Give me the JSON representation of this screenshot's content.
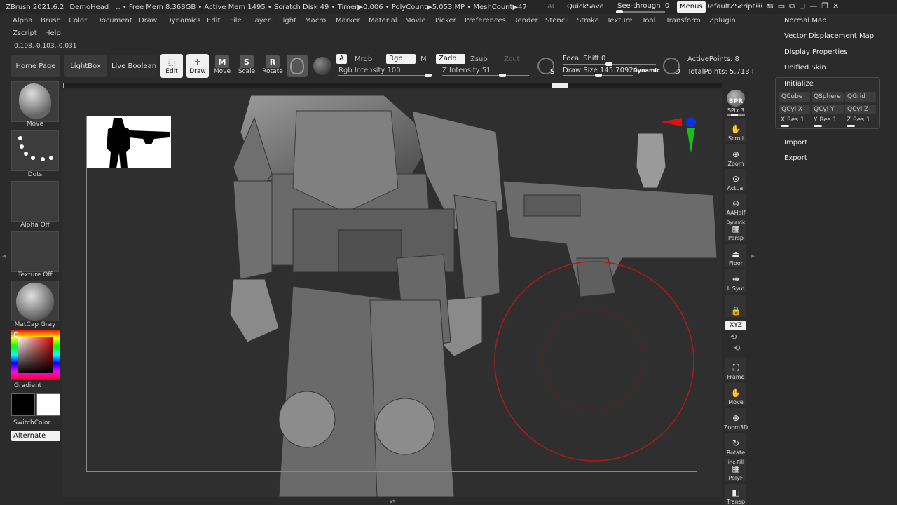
{
  "titlebar": {
    "app": "ZBrush 2021.6.2",
    "doc": "DemoHead",
    "stats": ".. • Free Mem 8.368GB • Active Mem 1495 • Scratch Disk 49 • Timer▶0.006 • PolyCount▶5.053 MP • MeshCount▶47",
    "ac": "AC",
    "quicksave": "QuickSave",
    "seethrough_label": "See-through",
    "seethrough_value": "0",
    "seethrough_level": 0,
    "menus": "Menus",
    "zscript": "DefaultZScript"
  },
  "menubar": {
    "row1": [
      "Alpha",
      "Brush",
      "Color",
      "Document",
      "Draw",
      "Dynamics",
      "Edit",
      "File",
      "Layer",
      "Light",
      "Macro",
      "Marker",
      "Material",
      "Movie",
      "Picker",
      "Preferences",
      "Render",
      "Stencil",
      "Stroke",
      "Texture",
      "Tool",
      "Transform",
      "Zplugin"
    ],
    "row2": [
      "Zscript",
      "Help"
    ]
  },
  "coords": "0.198,-0.103,-0.031",
  "toolbar": {
    "home_page": "Home Page",
    "lightbox": "LightBox",
    "live_boolean": "Live Boolean",
    "edit": "Edit",
    "draw": "Draw",
    "move": "Move",
    "scale": "Scale",
    "rotate": "Rotate",
    "a": "A",
    "mrgb": "Mrgb",
    "rgb": "Rgb",
    "m": "M",
    "zadd": "Zadd",
    "zsub": "Zsub",
    "zcut": "Zcut",
    "rgb_intensity_label": "Rgb Intensity",
    "rgb_intensity": "100",
    "z_intensity_label": "Z Intensity",
    "z_intensity": "51",
    "focal_shift_label": "Focal Shift",
    "focal_shift": "0",
    "draw_size_label": "Draw Size",
    "draw_size": "145.70924",
    "dynamic": "Dynamic",
    "active_points_label": "ActivePoints:",
    "active_points": "8",
    "total_points_label": "TotalPoints:",
    "total_points": "5.713 I",
    "s_badge": "S",
    "d_badge": "D"
  },
  "leftshelf": {
    "brush": "Move",
    "stroke": "Dots",
    "alpha": "Alpha Off",
    "texture": "Texture Off",
    "material": "MatCap Gray",
    "gradient": "Gradient",
    "switchcolor": "SwitchColor",
    "alternate": "Alternate"
  },
  "rightshelf": {
    "bpr": "BPR",
    "spix_label": "SPix",
    "spix": "3",
    "scroll": "Scroll",
    "zoom": "Zoom",
    "actual": "Actual",
    "aahalf": "AAHalf",
    "dynamic": "Dynamic",
    "persp": "Persp",
    "floor": "Floor",
    "lsym": "L.Sym",
    "xyz": "XYZ",
    "frame": "Frame",
    "move": "Move",
    "zoom3d": "Zoom3D",
    "rotate": "Rotate",
    "line_fill": "ine Fill",
    "polyf": "PolyF",
    "transp": "Transp"
  },
  "palette": {
    "normal_map": "Normal Map",
    "vector_displacement_map": "Vector Displacement Map",
    "display_properties": "Display Properties",
    "unified_skin": "Unified Skin",
    "initialize": "Initialize",
    "qcube": "QCube",
    "qsphere": "QSphere",
    "qgrid": "QGrid",
    "qcylx": "QCyl X",
    "qcyly": "QCyl Y",
    "qcylz": "QCyl Z",
    "xres": "X Res 1",
    "yres": "Y Res 1",
    "zres": "Z Res 1",
    "import": "Import",
    "export": "Export"
  }
}
